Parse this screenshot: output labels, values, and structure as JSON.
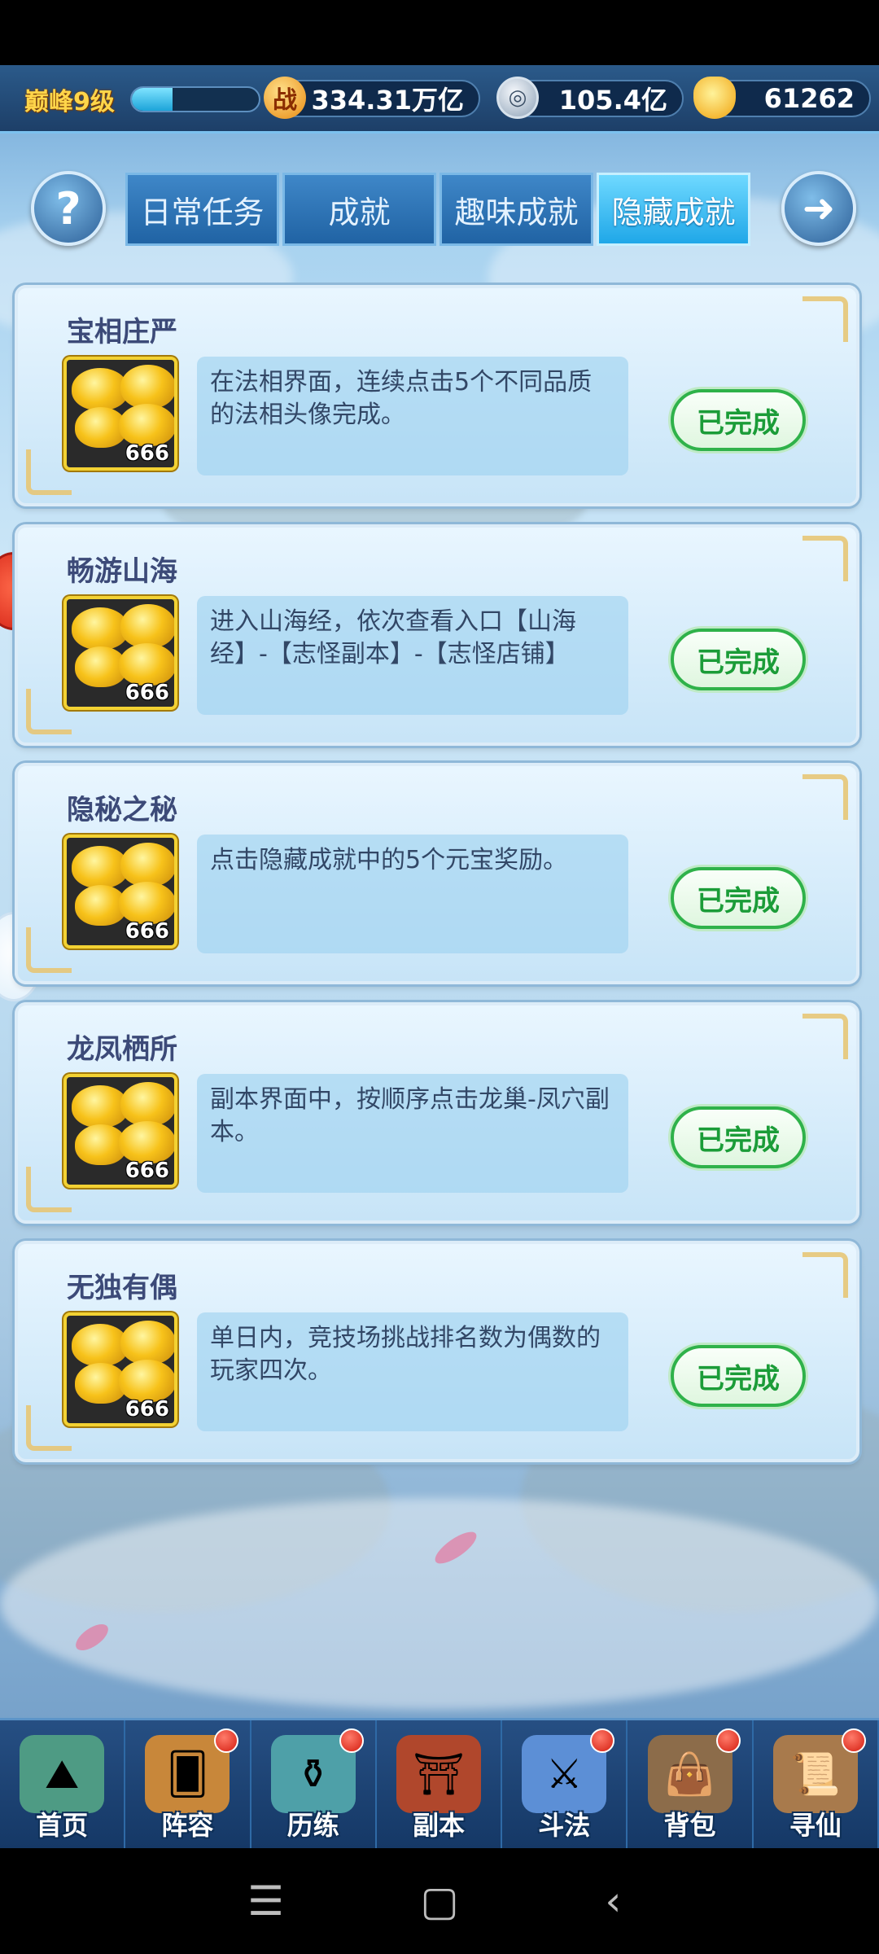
{
  "topbar": {
    "level": "巅峰9级",
    "xp_progress": 0.32,
    "power_icon_glyph": "战",
    "power": "334.31万亿",
    "coins": "105.4亿",
    "ingots": "61262"
  },
  "tabs": [
    {
      "label": "日常任务",
      "active": false
    },
    {
      "label": "成就",
      "active": false
    },
    {
      "label": "趣味成就",
      "active": false
    },
    {
      "label": "隐藏成就",
      "active": true
    }
  ],
  "help_glyph": "?",
  "achievements": [
    {
      "title": "宝相庄严",
      "reward_count": "666",
      "description": "在法相界面，连续点击5个不同品质的法相头像完成。",
      "status": "已完成"
    },
    {
      "title": "畅游山海",
      "reward_count": "666",
      "description": "进入山海经，依次查看入口【山海经】-【志怪副本】-【志怪店铺】",
      "status": "已完成"
    },
    {
      "title": "隐秘之秘",
      "reward_count": "666",
      "description": "点击隐藏成就中的5个元宝奖励。",
      "status": "已完成"
    },
    {
      "title": "龙凤栖所",
      "reward_count": "666",
      "description": "副本界面中，按顺序点击龙巢-凤穴副本。",
      "status": "已完成"
    },
    {
      "title": "无独有偶",
      "reward_count": "666",
      "description": "单日内，竞技场挑战排名数为偶数的玩家四次。",
      "status": "已完成"
    }
  ],
  "bottom_nav": [
    {
      "label": "首页",
      "icon": "home-island-icon",
      "badge": false
    },
    {
      "label": "阵容",
      "icon": "lineup-cards-icon",
      "badge": true
    },
    {
      "label": "历练",
      "icon": "training-gourd-icon",
      "badge": true
    },
    {
      "label": "副本",
      "icon": "dungeon-gate-icon",
      "badge": false
    },
    {
      "label": "斗法",
      "icon": "battle-tower-icon",
      "badge": true
    },
    {
      "label": "背包",
      "icon": "bag-icon",
      "badge": true
    },
    {
      "label": "寻仙",
      "icon": "scroll-icon",
      "badge": true
    }
  ],
  "colors": {
    "accent": "#1fa7e8",
    "done_green": "#2fb24a",
    "gold": "#f3d233"
  }
}
